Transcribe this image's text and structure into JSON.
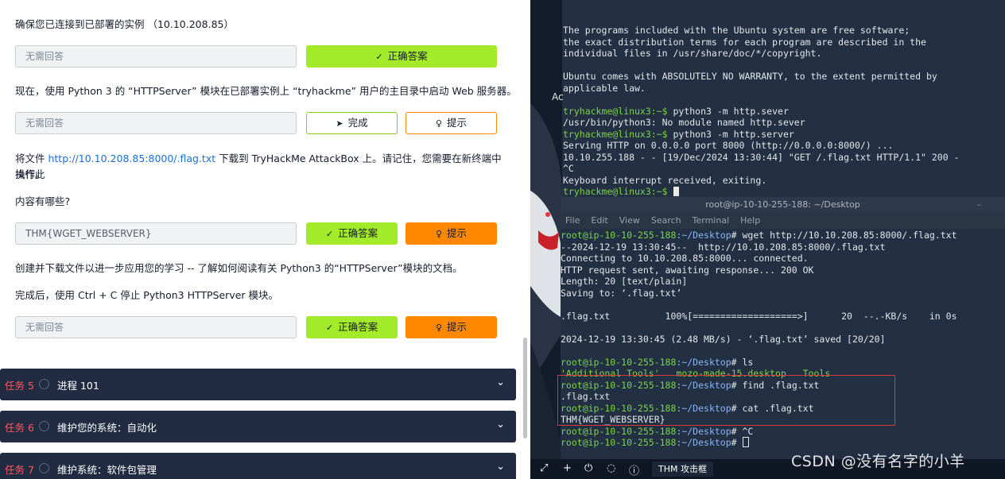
{
  "left": {
    "q1": "确保您已连接到已部署的实例 （10.10.208.85）",
    "q1_answer_placeholder": "无需回答",
    "q1_button": "正确答案",
    "q2": "现在，使用 Python 3 的 “HTTPServer” 模块在已部署实例上 “tryhackme” 用户的主目录中启动 Web 服务器。",
    "q2_answer_placeholder": "无需回答",
    "q2_complete": "完成",
    "q2_hint": "提示",
    "q3_prefix": "将文件 ",
    "q3_link": "http://10.10.208.85:8000/.flag.txt",
    "q3_suffix": " 下载到 TryHackMe AttackBox 上。请记住，您需要在新终端中执行此",
    "q3_line2": "操作。",
    "q4": "内容有哪些?",
    "q4_answer": "THM{WGET_WEBSERVER}",
    "q4_correct": "正确答案",
    "q4_hint": "提示",
    "q5": "创建并下载文件以进一步应用您的学习 -- 了解如何阅读有关 Python3 的“HTTPServer”模块的文档。",
    "q6": "完成后，使用 Ctrl + C 停止 Python3 HTTPServer 模块。",
    "q6_answer_placeholder": "无需回答",
    "q6_correct": "正确答案",
    "q6_hint": "提示",
    "tasks": [
      {
        "num": "任务 5",
        "title": "进程 101"
      },
      {
        "num": "任务 6",
        "title": "维护您的系统：自动化"
      },
      {
        "num": "任务 7",
        "title": "维护系统：软件包管理"
      }
    ]
  },
  "right": {
    "term1_lines": [
      "The programs included with the Ubuntu system are free software;",
      "the exact distribution terms for each program are described in the",
      "individual files in /usr/share/doc/*/copyright.",
      "",
      "Ubuntu comes with ABSOLUTELY NO WARRANTY, to the extent permitted by",
      "applicable law."
    ],
    "term1_prompt": "tryhackme@linux3:~$",
    "term1_cmd1": " python3 -m http.sever",
    "term1_err": "/usr/bin/python3: No module named http.sever",
    "term1_cmd2": " python3 -m http.server",
    "term1_out": [
      "Serving HTTP on 0.0.0.0 port 8000 (http://0.0.0.0:8000/) ...",
      "10.10.255.188 - - [19/Dec/2024 13:30:44] \"GET /.flag.txt HTTP/1.1\" 200 -",
      "^C",
      "Keyboard interrupt received, exiting."
    ],
    "ac_label": "Ac",
    "term2_title": "root@ip-10-10-255-188: ~/Desktop",
    "term2_menu": [
      "File",
      "Edit",
      "View",
      "Search",
      "Terminal",
      "Help"
    ],
    "root_prompt": "root@ip-10-10-255-188",
    "root_path": ":~/Desktop",
    "wget_cmd": "# wget http://10.10.208.85:8000/.flag.txt",
    "wget_out": [
      "--2024-12-19 13:30:45--  http://10.10.208.85:8000/.flag.txt",
      "Connecting to 10.10.208.85:8000... connected.",
      "HTTP request sent, awaiting response... 200 OK",
      "Length: 20 [text/plain]",
      "Saving to: ‘.flag.txt’",
      "",
      ".flag.txt          100%[===================>]      20  --.-KB/s    in 0s",
      "",
      "2024-12-19 13:30:45 (2.48 MB/s) - ‘.flag.txt’ saved [20/20]",
      ""
    ],
    "ls_cmd": "# ls",
    "ls_out": "'Additional Tools'   mozo-made-15.desktop   Tools",
    "find_cmd": "# find .flag.txt",
    "find_out": ".flag.txt",
    "cat_cmd": "# cat .flag.txt",
    "cat_out": "THM{WGET_WEBSERVER}",
    "ctrlc_cmd": "# ^C",
    "last_cmd": "# ",
    "taskbar_label": "THM 攻击框"
  },
  "watermark": "CSDN @没有名字的小羊",
  "colors": {
    "accent_green": "#a3ea2a",
    "accent_orange": "#ff8800",
    "task_bar": "#212c42",
    "task_number": "#ff575f",
    "link": "#1f6fd1",
    "terminal_bg": "#233043",
    "prompt_green": "#7dd34a",
    "path_blue": "#8ab4f8",
    "highlight_red": "#d9383a"
  }
}
